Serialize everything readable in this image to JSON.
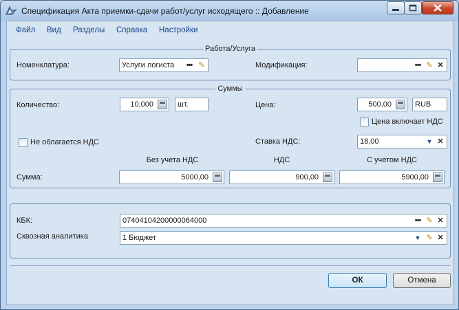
{
  "window": {
    "title": "Спецификация Акта приемки-сдачи работ/услуг исходящего  :: Добавление",
    "buttons": {
      "close_symbol": "✕",
      "min_symbol": "—",
      "max_symbol": "☐"
    }
  },
  "menu": {
    "items": [
      {
        "label": "Файл"
      },
      {
        "label": "Вид"
      },
      {
        "label": "Разделы"
      },
      {
        "label": "Справка"
      },
      {
        "label": "Настройки"
      }
    ]
  },
  "work_group": {
    "title": "Работа/Услуга",
    "nomenclature_label": "Номенклатура:",
    "nomenclature_value": "Услуги логиста",
    "modification_label": "Модификация:",
    "modification_value": ""
  },
  "sums_group": {
    "title": "Суммы",
    "quantity_label": "Количество:",
    "quantity_value": "10,000",
    "unit_value": "шт.",
    "price_label": "Цена:",
    "price_value": "500,00",
    "currency_value": "RUB",
    "price_includes_vat_label": "Цена включает НДС",
    "price_includes_vat_checked": false,
    "no_vat_label": "Не облагается НДС",
    "no_vat_checked": false,
    "vat_rate_label": "Ставка НДС:",
    "vat_rate_value": "18,00",
    "col_without_vat": "Без учета НДС",
    "col_vat": "НДС",
    "col_with_vat": "С учетом НДС",
    "sum_label": "Сумма:",
    "sum_without_vat": "5000,00",
    "sum_vat": "900,00",
    "sum_with_vat": "5900,00"
  },
  "analytics_group": {
    "kbk_label": "КБК:",
    "kbk_value": "07404104200000064000",
    "through_label": "Сквозная аналитика",
    "through_value": "1 Бюджет"
  },
  "icons": {
    "dots": "•••",
    "edit": "✎",
    "clear": "✕",
    "dropdown": "▼"
  },
  "footer": {
    "ok_label": "ОК",
    "cancel_label": "Отмена"
  }
}
